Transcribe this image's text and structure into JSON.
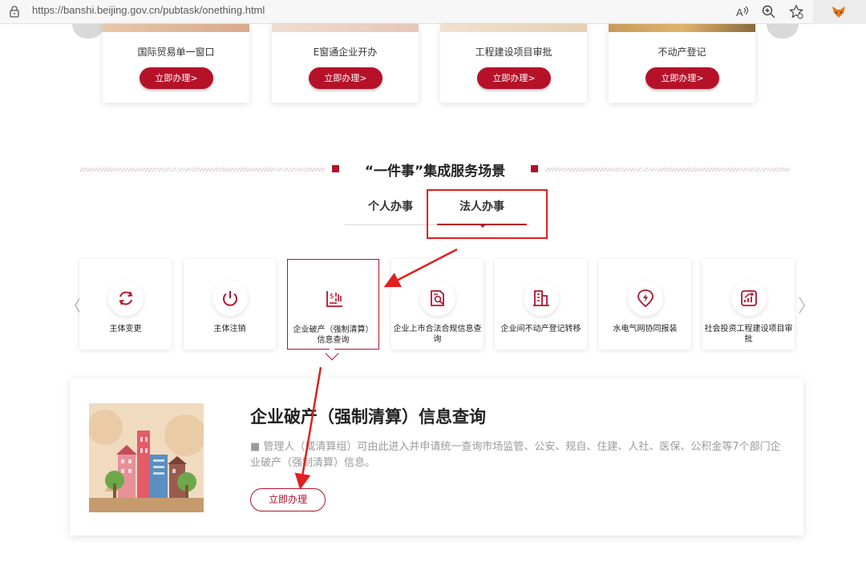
{
  "browser": {
    "url": "https://banshi.beijing.gov.cn/pubtask/onething.html"
  },
  "top_services": [
    {
      "title": "国际贸易单一窗口",
      "button": "立即办理>"
    },
    {
      "title": "E窗通企业开办",
      "button": "立即办理>"
    },
    {
      "title": "工程建设项目审批",
      "button": "立即办理>"
    },
    {
      "title": "不动产登记",
      "button": "立即办理>"
    }
  ],
  "section": {
    "title": "“一件事”集成服务场景"
  },
  "tabs": [
    {
      "label": "个人办事",
      "active": false
    },
    {
      "label": "法人办事",
      "active": true
    }
  ],
  "services": [
    {
      "label": "主体变更",
      "icon": "refresh-icon"
    },
    {
      "label": "主体注销",
      "icon": "power-icon"
    },
    {
      "label": "企业破产（强制清算）信息查询",
      "icon": "finance-chart-icon",
      "active": true
    },
    {
      "label": "企业上市合法合规信息查询",
      "icon": "document-search-icon"
    },
    {
      "label": "企业间不动产登记转移",
      "icon": "building-icon"
    },
    {
      "label": "水电气网协同报装",
      "icon": "lightning-icon"
    },
    {
      "label": "社会投资工程建设项目审批",
      "icon": "growth-chart-icon"
    }
  ],
  "detail": {
    "title": "企业破产（强制清算）信息查询",
    "description": "■  管理人（或清算组）可由此进入并申请统一查询市场监管、公安、规自、住建、人社、医保、公积金等7个部门企业破产（强制清算）信息。",
    "button": "立即办理"
  },
  "colors": {
    "accent": "#b5122a",
    "annotation": "#e02020"
  }
}
